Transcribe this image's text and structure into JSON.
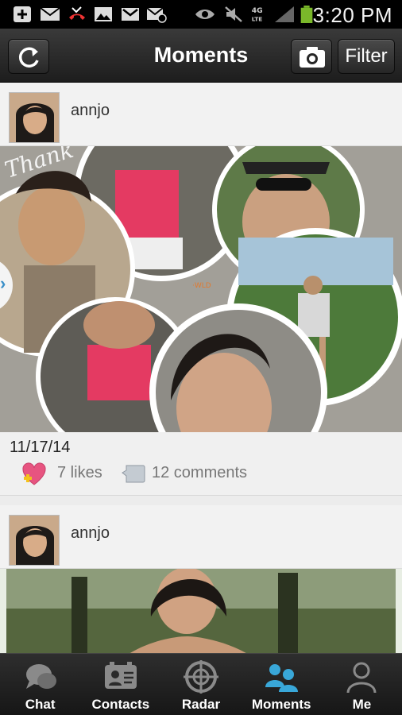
{
  "status_bar": {
    "time": "3:20 PM",
    "icons": [
      "plus-box-icon",
      "mail-icon",
      "missed-call-icon",
      "image-icon",
      "gmail-icon",
      "mail-sync-icon",
      "eye-icon",
      "mute-icon",
      "4g-lte-icon",
      "signal-icon",
      "battery-icon"
    ]
  },
  "header": {
    "title": "Moments",
    "filter_label": "Filter",
    "refresh_icon": "refresh-icon",
    "camera_icon": "camera-icon"
  },
  "posts": [
    {
      "username": "annjo",
      "date": "11/17/14",
      "likes": "7 likes",
      "comments": "12 comments",
      "photo_overlay_text": "Thank"
    },
    {
      "username": "annjo"
    }
  ],
  "nav": {
    "items": [
      {
        "label": "Chat",
        "icon": "chat-icon"
      },
      {
        "label": "Contacts",
        "icon": "contacts-icon"
      },
      {
        "label": "Radar",
        "icon": "radar-icon"
      },
      {
        "label": "Moments",
        "icon": "moments-icon",
        "active": true
      },
      {
        "label": "Me",
        "icon": "profile-icon"
      }
    ],
    "active_color": "#39a7d8"
  }
}
